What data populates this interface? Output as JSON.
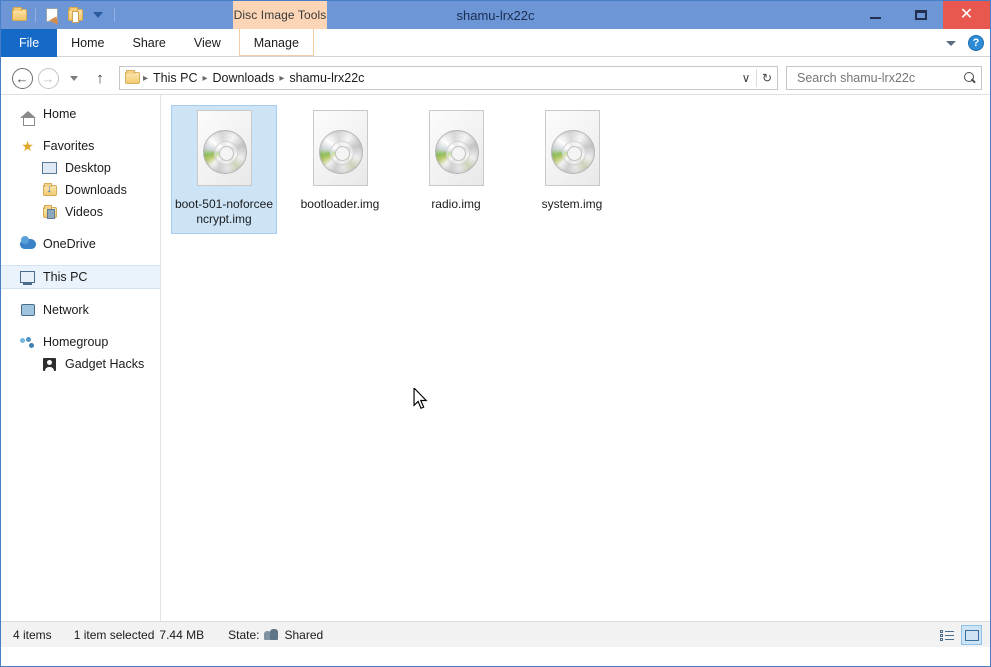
{
  "window": {
    "title": "shamu-lrx22c",
    "contextual_tab_label": "Disc Image Tools",
    "minimize_label": "Minimize",
    "maximize_label": "Maximize",
    "close_label": "Close"
  },
  "quick_access": {
    "items": [
      {
        "name": "folder-icon",
        "label": "Folder"
      },
      {
        "name": "properties-icon",
        "label": "Properties"
      },
      {
        "name": "new-folder-icon",
        "label": "New folder"
      },
      {
        "name": "customize-caret",
        "label": "Customize Quick Access Toolbar"
      }
    ]
  },
  "ribbon": {
    "tabs": [
      {
        "label": "File",
        "selected": false,
        "style": "file"
      },
      {
        "label": "Home",
        "selected": false,
        "style": "normal"
      },
      {
        "label": "Share",
        "selected": false,
        "style": "normal"
      },
      {
        "label": "View",
        "selected": false,
        "style": "normal"
      },
      {
        "label": "Manage",
        "selected": false,
        "style": "contextual"
      }
    ],
    "collapse_label": "Minimize the Ribbon",
    "help_label": "?"
  },
  "navigation": {
    "back_label": "←",
    "forward_label": "→",
    "recent_label": "Recent locations",
    "up_label": "↑"
  },
  "breadcrumb": {
    "segments": [
      "This PC",
      "Downloads",
      "shamu-lrx22c"
    ],
    "separator": "▸",
    "dropdown_label": "∨",
    "refresh_label": "↻"
  },
  "search": {
    "placeholder": "Search shamu-lrx22c",
    "value": ""
  },
  "sidebar": {
    "items": [
      {
        "label": "Home",
        "icon": "home-icon",
        "level": 0,
        "selected": false,
        "gap_before": false
      },
      {
        "label": "Favorites",
        "icon": "star-icon",
        "level": 0,
        "selected": false,
        "gap_before": true
      },
      {
        "label": "Desktop",
        "icon": "desktop-icon",
        "level": 1,
        "selected": false,
        "gap_before": false
      },
      {
        "label": "Downloads",
        "icon": "downloads-folder-icon",
        "level": 1,
        "selected": false,
        "gap_before": false
      },
      {
        "label": "Videos",
        "icon": "videos-folder-icon",
        "level": 1,
        "selected": false,
        "gap_before": false
      },
      {
        "label": "OneDrive",
        "icon": "onedrive-icon",
        "level": 0,
        "selected": false,
        "gap_before": true
      },
      {
        "label": "This PC",
        "icon": "this-pc-icon",
        "level": 0,
        "selected": true,
        "gap_before": true
      },
      {
        "label": "Network",
        "icon": "network-icon",
        "level": 0,
        "selected": false,
        "gap_before": true
      },
      {
        "label": "Homegroup",
        "icon": "homegroup-icon",
        "level": 0,
        "selected": false,
        "gap_before": true
      },
      {
        "label": "Gadget Hacks",
        "icon": "user-icon",
        "level": 1,
        "selected": false,
        "gap_before": false
      }
    ]
  },
  "files": [
    {
      "name": "boot-501-noforceencrypt.img",
      "icon": "disc-image-icon",
      "selected": true
    },
    {
      "name": "bootloader.img",
      "icon": "disc-image-icon",
      "selected": false
    },
    {
      "name": "radio.img",
      "icon": "disc-image-icon",
      "selected": false
    },
    {
      "name": "system.img",
      "icon": "disc-image-icon",
      "selected": false
    }
  ],
  "status": {
    "item_count": "4 items",
    "selection": "1 item selected",
    "selection_size": "7.44 MB",
    "state_label": "State:",
    "state_value": "Shared"
  },
  "view_buttons": [
    {
      "name": "details-view-button",
      "label": "Details view",
      "active": false
    },
    {
      "name": "large-icons-view-button",
      "label": "Large icons view",
      "active": true
    }
  ],
  "colors": {
    "titlebar": "#6d96d6",
    "file_tab": "#1569c7",
    "contextual_tab": "#fbd5b5",
    "close_button": "#e8584e",
    "selection": "#cde4f7",
    "status_bar": "#f2f2f2"
  }
}
